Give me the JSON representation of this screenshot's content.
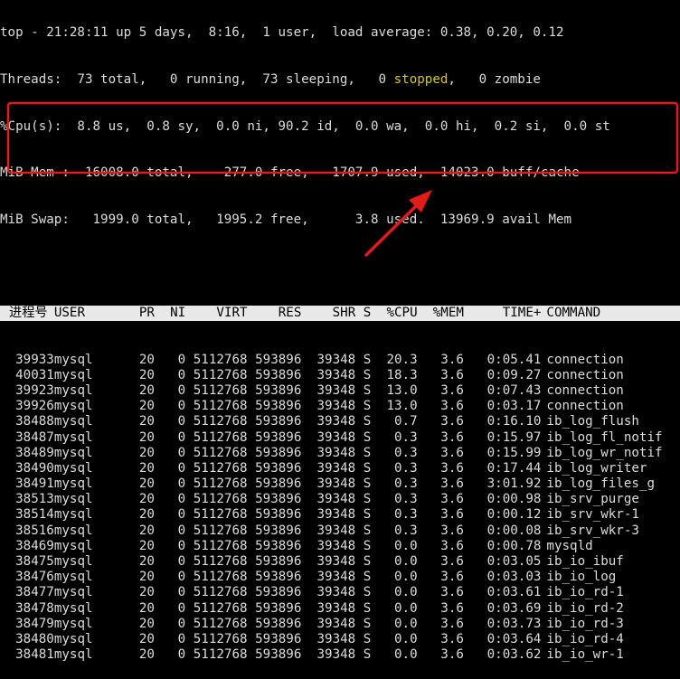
{
  "summary": {
    "line1": "top - 21:28:11 up 5 days,  8:16,  1 user,  load average: 0.38, 0.20, 0.12",
    "threads_pre": "Threads:  73 total,   0 running,  73 sleeping,   0 ",
    "threads_stopped": "stopped",
    "threads_post": ",   0 zombie",
    "cpu": "%Cpu(s):  8.8 us,  0.8 sy,  0.0 ni, 90.2 id,  0.0 wa,  0.0 hi,  0.2 si,  0.0 st",
    "mem": "MiB Mem :  16008.0 total,    277.0 free,   1707.9 used,  14023.0 buff/cache",
    "swap": "MiB Swap:   1999.0 total,   1995.2 free,      3.8 used.  13969.9 avail Mem"
  },
  "table": {
    "columns": [
      "进程号",
      "USER",
      "PR",
      "NI",
      "VIRT",
      "RES",
      "SHR",
      "S",
      "%CPU",
      "%MEM",
      "TIME+",
      "COMMAND"
    ],
    "rows": [
      [
        "39933",
        "mysql",
        "20",
        "0",
        "5112768",
        "593896",
        "39348",
        "S",
        "20.3",
        "3.6",
        "0:05.41",
        "connection"
      ],
      [
        "40031",
        "mysql",
        "20",
        "0",
        "5112768",
        "593896",
        "39348",
        "S",
        "18.3",
        "3.6",
        "0:09.27",
        "connection"
      ],
      [
        "39923",
        "mysql",
        "20",
        "0",
        "5112768",
        "593896",
        "39348",
        "S",
        "13.0",
        "3.6",
        "0:07.43",
        "connection"
      ],
      [
        "39926",
        "mysql",
        "20",
        "0",
        "5112768",
        "593896",
        "39348",
        "S",
        "13.0",
        "3.6",
        "0:03.17",
        "connection"
      ],
      [
        "38488",
        "mysql",
        "20",
        "0",
        "5112768",
        "593896",
        "39348",
        "S",
        "0.7",
        "3.6",
        "0:16.10",
        "ib_log_flush"
      ],
      [
        "38487",
        "mysql",
        "20",
        "0",
        "5112768",
        "593896",
        "39348",
        "S",
        "0.3",
        "3.6",
        "0:15.97",
        "ib_log_fl_notif"
      ],
      [
        "38489",
        "mysql",
        "20",
        "0",
        "5112768",
        "593896",
        "39348",
        "S",
        "0.3",
        "3.6",
        "0:15.99",
        "ib_log_wr_notif"
      ],
      [
        "38490",
        "mysql",
        "20",
        "0",
        "5112768",
        "593896",
        "39348",
        "S",
        "0.3",
        "3.6",
        "0:17.44",
        "ib_log_writer"
      ],
      [
        "38491",
        "mysql",
        "20",
        "0",
        "5112768",
        "593896",
        "39348",
        "S",
        "0.3",
        "3.6",
        "3:01.92",
        "ib_log_files_g"
      ],
      [
        "38513",
        "mysql",
        "20",
        "0",
        "5112768",
        "593896",
        "39348",
        "S",
        "0.3",
        "3.6",
        "0:00.98",
        "ib_srv_purge"
      ],
      [
        "38514",
        "mysql",
        "20",
        "0",
        "5112768",
        "593896",
        "39348",
        "S",
        "0.3",
        "3.6",
        "0:00.12",
        "ib_srv_wkr-1"
      ],
      [
        "38516",
        "mysql",
        "20",
        "0",
        "5112768",
        "593896",
        "39348",
        "S",
        "0.3",
        "3.6",
        "0:00.08",
        "ib_srv_wkr-3"
      ],
      [
        "38469",
        "mysql",
        "20",
        "0",
        "5112768",
        "593896",
        "39348",
        "S",
        "0.0",
        "3.6",
        "0:00.78",
        "mysqld"
      ],
      [
        "38475",
        "mysql",
        "20",
        "0",
        "5112768",
        "593896",
        "39348",
        "S",
        "0.0",
        "3.6",
        "0:03.05",
        "ib_io_ibuf"
      ],
      [
        "38476",
        "mysql",
        "20",
        "0",
        "5112768",
        "593896",
        "39348",
        "S",
        "0.0",
        "3.6",
        "0:03.03",
        "ib_io_log"
      ],
      [
        "38477",
        "mysql",
        "20",
        "0",
        "5112768",
        "593896",
        "39348",
        "S",
        "0.0",
        "3.6",
        "0:03.61",
        "ib_io_rd-1"
      ],
      [
        "38478",
        "mysql",
        "20",
        "0",
        "5112768",
        "593896",
        "39348",
        "S",
        "0.0",
        "3.6",
        "0:03.69",
        "ib_io_rd-2"
      ],
      [
        "38479",
        "mysql",
        "20",
        "0",
        "5112768",
        "593896",
        "39348",
        "S",
        "0.0",
        "3.6",
        "0:03.73",
        "ib_io_rd-3"
      ],
      [
        "38480",
        "mysql",
        "20",
        "0",
        "5112768",
        "593896",
        "39348",
        "S",
        "0.0",
        "3.6",
        "0:03.64",
        "ib_io_rd-4"
      ],
      [
        "38481",
        "mysql",
        "20",
        "0",
        "5112768",
        "593896",
        "39348",
        "S",
        "0.0",
        "3.6",
        "0:03.62",
        "ib_io_wr-1"
      ]
    ]
  },
  "annotation": {
    "highlight_color": "#e21b1b",
    "arrow_color": "#e21b1b",
    "highlighted_rows": 4
  }
}
